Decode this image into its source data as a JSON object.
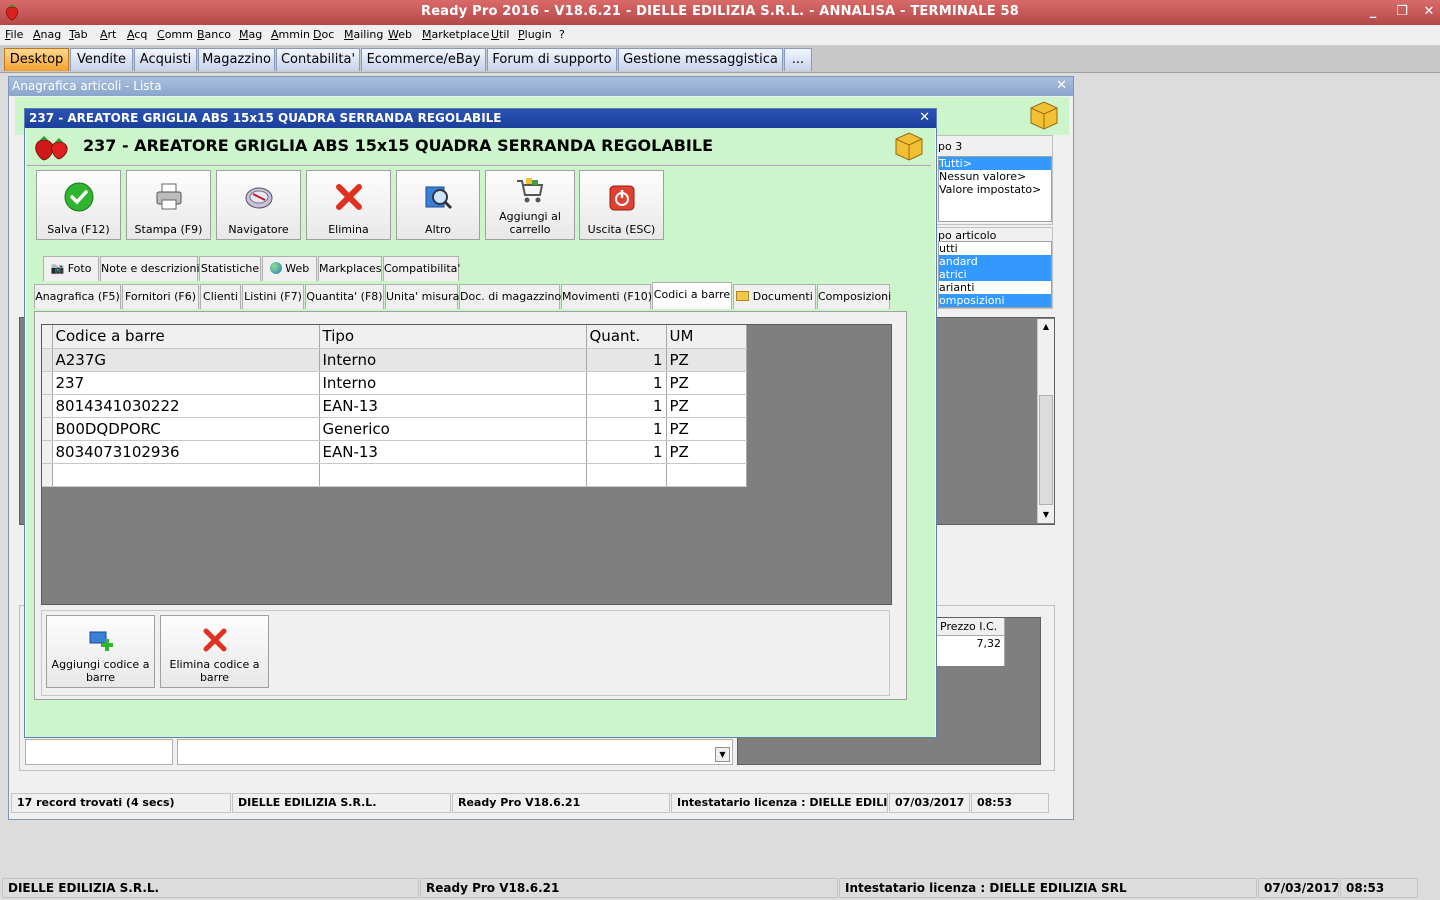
{
  "window": {
    "title": "Ready Pro 2016 - V18.6.21 - DIELLE EDILIZIA S.R.L. - ANNALISA - TERMINALE 58"
  },
  "menu": [
    "File",
    "Anag",
    "Tab",
    "Art",
    "Acq",
    "Comm",
    "Banco",
    "Mag",
    "Ammin",
    "Doc",
    "Mailing",
    "Web",
    "Marketplace",
    "Util",
    "Plugin",
    "?"
  ],
  "main_tabs": [
    "Desktop",
    "Vendite",
    "Acquisti",
    "Magazzino",
    "Contabilita'",
    "Ecommerce/eBay",
    "Forum di supporto",
    "Gestione messaggistica",
    "..."
  ],
  "list_window": {
    "title": "Anagrafica articoli  - Lista",
    "gruppo3_label": "po 3",
    "gruppo3_items": [
      "Tutti>",
      "Nessun valore>",
      "Valore impostato>"
    ],
    "tipo_label": "po articolo",
    "tipo_items": [
      "utti",
      "andard",
      "atrici",
      "arianti",
      "omposizioni"
    ],
    "price_header": "Prezzo I.C.",
    "price_value": "7,32",
    "status": {
      "records": "17 record trovati (4 secs)",
      "company": "DIELLE EDILIZIA S.R.L.",
      "version": "Ready Pro V18.6.21",
      "license": "Intestatario licenza : DIELLE EDILIZIA",
      "date": "07/03/2017",
      "time": "08:53"
    }
  },
  "article_window": {
    "caption": "237 - AREATORE GRIGLIA ABS 15x15 QUADRA SERRANDA REGOLABILE",
    "header_title": "237 - AREATORE GRIGLIA ABS 15x15 QUADRA SERRANDA REGOLABILE",
    "toolbar": {
      "save": "Salva (F12)",
      "print": "Stampa (F9)",
      "navigator": "Navigatore",
      "delete": "Elimina",
      "other": "Altro",
      "cart": "Aggiungi al carrello",
      "exit": "Uscita (ESC)"
    },
    "tabs_row1": [
      "Foto",
      "Note e descrizioni",
      "Statistiche",
      "Web",
      "Markplaces",
      "Compatibilita'"
    ],
    "tabs_row2": [
      "Anagrafica (F5)",
      "Fornitori (F6)",
      "Clienti",
      "Listini (F7)",
      "Quantita' (F8)",
      "Unita' misura",
      "Doc. di magazzino",
      "Movimenti (F10)",
      "Codici a barre",
      "Documenti",
      "Composizioni"
    ],
    "grid": {
      "columns": [
        "Codice a barre",
        "Tipo",
        "Quant.",
        "UM"
      ],
      "rows": [
        [
          "A237G",
          "Interno",
          "1",
          "PZ"
        ],
        [
          "237",
          "Interno",
          "1",
          "PZ"
        ],
        [
          "8014341030222",
          "EAN-13",
          "1",
          "PZ"
        ],
        [
          "B00DQDPORC",
          "Generico",
          "1",
          "PZ"
        ],
        [
          "8034073102936",
          "EAN-13",
          "1",
          "PZ"
        ]
      ]
    },
    "actions": {
      "add": "Aggiungi codice a barre",
      "remove": "Elimina codice a barre"
    }
  },
  "bottom_status": {
    "company": "DIELLE EDILIZIA S.R.L.",
    "version": "Ready Pro V18.6.21",
    "license": "Intestatario licenza : DIELLE EDILIZIA SRL",
    "date": "07/03/2017",
    "time": "08:53"
  },
  "colors": {
    "title_bar": "#c45656",
    "active_tab": "#f3a030",
    "panel_green": "#ccf5cc",
    "caption_blue": "#1b3f9b"
  }
}
